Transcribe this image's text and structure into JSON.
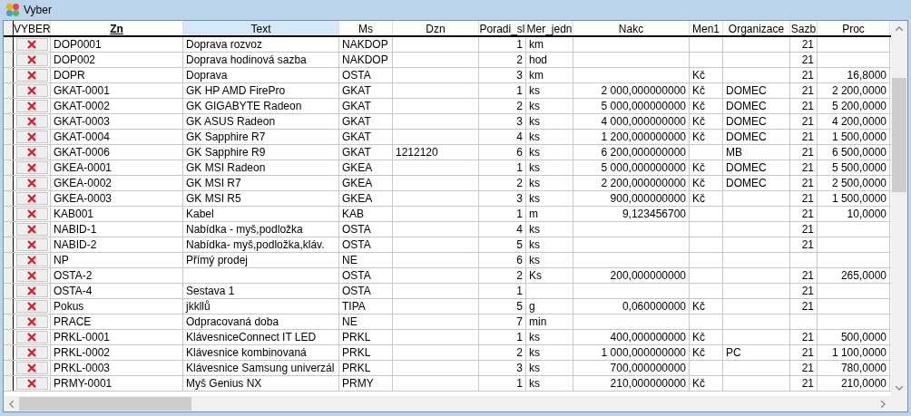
{
  "window": {
    "title": "Vyber"
  },
  "table": {
    "columns": [
      {
        "label": "VYBER",
        "sorted": false,
        "highlighted": false
      },
      {
        "label": "Zn",
        "sorted": true,
        "highlighted": false
      },
      {
        "label": "Text",
        "sorted": false,
        "highlighted": true
      },
      {
        "label": "Ms",
        "sorted": false,
        "highlighted": false
      },
      {
        "label": "Dzn",
        "sorted": false,
        "highlighted": false
      },
      {
        "label": "Poradi_sl",
        "sorted": false,
        "highlighted": false
      },
      {
        "label": "Mer_jedn",
        "sorted": false,
        "highlighted": false
      },
      {
        "label": "Nakc",
        "sorted": false,
        "highlighted": false
      },
      {
        "label": "Men1",
        "sorted": false,
        "highlighted": false
      },
      {
        "label": "Organizace",
        "sorted": false,
        "highlighted": false
      },
      {
        "label": "Sazb",
        "sorted": false,
        "highlighted": false
      },
      {
        "label": "Proc",
        "sorted": false,
        "highlighted": false
      }
    ],
    "rows": [
      {
        "cells": [
          "",
          "DOP0001",
          "Doprava rozvoz",
          "NAKDOP",
          "",
          "1",
          "km",
          "",
          "",
          "",
          "21",
          ""
        ]
      },
      {
        "cells": [
          "",
          "DOP002",
          "Doprava hodinová sazba",
          "NAKDOP",
          "",
          "2",
          "hod",
          "",
          "",
          "",
          "21",
          ""
        ]
      },
      {
        "cells": [
          "",
          "DOPR",
          "Doprava",
          "OSTA",
          "",
          "3",
          "km",
          "",
          "Kč",
          "",
          "21",
          "16,8000"
        ]
      },
      {
        "cells": [
          "",
          "GKAT-0001",
          "GK HP AMD FirePro",
          "GKAT",
          "",
          "1",
          "ks",
          "2 000,000000000",
          "Kč",
          "DOMEC",
          "21",
          "2 200,0000"
        ]
      },
      {
        "cells": [
          "",
          "GKAT-0002",
          "GK  GIGABYTE Radeon",
          "GKAT",
          "",
          "2",
          "ks",
          "5 000,000000000",
          "Kč",
          "DOMEC",
          "21",
          "5 200,0000"
        ]
      },
      {
        "cells": [
          "",
          "GKAT-0003",
          "GK ASUS Radeon",
          "GKAT",
          "",
          "3",
          "ks",
          "4 000,000000000",
          "Kč",
          "DOMEC",
          "21",
          "4 200,0000"
        ]
      },
      {
        "cells": [
          "",
          "GKAT-0004",
          "GK Sapphire R7",
          "GKAT",
          "",
          "4",
          "ks",
          "1 200,000000000",
          "Kč",
          "DOMEC",
          "21",
          "1 500,0000"
        ]
      },
      {
        "cells": [
          "",
          "GKAT-0006",
          "GK Sapphire R9",
          "GKAT",
          "1212120",
          "6",
          "ks",
          "6 200,000000000",
          "",
          "MB",
          "21",
          "6 500,0000"
        ]
      },
      {
        "cells": [
          "",
          "GKEA-0001",
          "GK MSI  Radeon",
          "GKEA",
          "",
          "1",
          "ks",
          "5 000,000000000",
          "Kč",
          "DOMEC",
          "21",
          "5 500,0000"
        ]
      },
      {
        "cells": [
          "",
          "GKEA-0002",
          "GK MSI R7",
          "GKEA",
          "",
          "2",
          "ks",
          "2 200,000000000",
          "Kč",
          "DOMEC",
          "21",
          "2 500,0000"
        ]
      },
      {
        "cells": [
          "",
          "GKEA-0003",
          "GK MSI R5",
          "GKEA",
          "",
          "3",
          "ks",
          "900,000000000",
          "Kč",
          "",
          "21",
          "1 500,0000"
        ]
      },
      {
        "cells": [
          "",
          "KAB001",
          "Kabel",
          "KAB",
          "",
          "1",
          "m",
          "9,123456700",
          "",
          "",
          "21",
          "10,0000"
        ]
      },
      {
        "cells": [
          "",
          "NABID-1",
          "Nabídka - myš,podložka",
          "OSTA",
          "",
          "4",
          "ks",
          "",
          "",
          "",
          "21",
          ""
        ]
      },
      {
        "cells": [
          "",
          "NABID-2",
          "Nabídka- myš,podložka,kláv.",
          "OSTA",
          "",
          "5",
          "ks",
          "",
          "",
          "",
          "21",
          ""
        ]
      },
      {
        "cells": [
          "",
          "NP",
          "Přímý prodej",
          "NE",
          "",
          "6",
          "ks",
          "",
          "",
          "",
          "",
          ""
        ]
      },
      {
        "cells": [
          "",
          "OSTA-2",
          "",
          "OSTA",
          "",
          "2",
          "Ks",
          "200,000000000",
          "",
          "",
          "21",
          "265,0000"
        ]
      },
      {
        "cells": [
          "",
          "OSTA-4",
          "Sestava 1",
          "OSTA",
          "",
          "1",
          "",
          "",
          "",
          "",
          "21",
          ""
        ]
      },
      {
        "cells": [
          "",
          "Pokus",
          "jkkllů",
          "TIPA",
          "",
          "5",
          "g",
          "0,060000000",
          "Kč",
          "",
          "21",
          ""
        ]
      },
      {
        "cells": [
          "",
          "PRACE",
          "Odpracovaná doba",
          "NE",
          "",
          "7",
          "min",
          "",
          "",
          "",
          "",
          ""
        ]
      },
      {
        "cells": [
          "",
          "PRKL-0001",
          "KlávesniceConnect IT LED",
          "PRKL",
          "",
          "1",
          "ks",
          "400,000000000",
          "Kč",
          "",
          "21",
          "500,0000"
        ]
      },
      {
        "cells": [
          "",
          "PRKL-0002",
          "Klávesnice kombinovaná",
          "PRKL",
          "",
          "2",
          "ks",
          "1 000,000000000",
          "Kč",
          "PC",
          "21",
          "1 100,0000"
        ]
      },
      {
        "cells": [
          "",
          "PRKL-0003",
          "Klávesnice Samsung univerzál",
          "PRKL",
          "",
          "3",
          "ks",
          "700,000000000",
          "",
          "",
          "21",
          "780,0000"
        ]
      },
      {
        "cells": [
          "",
          "PRMY-0001",
          "Myš Genius NX",
          "PRMY",
          "",
          "1",
          "ks",
          "210,000000000",
          "Kč",
          "",
          "21",
          "210,0000"
        ]
      }
    ]
  }
}
